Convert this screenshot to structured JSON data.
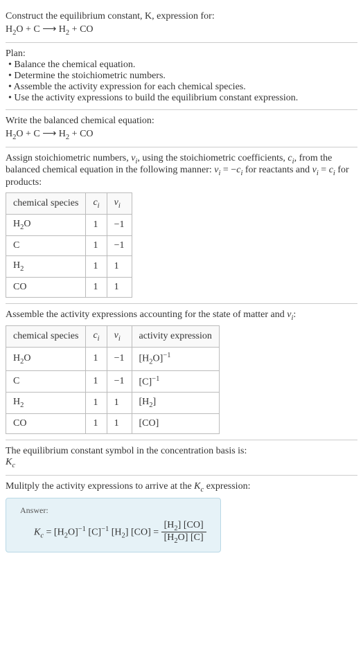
{
  "intro": {
    "prompt": "Construct the equilibrium constant, K, expression for:",
    "equation_lhs1": "H",
    "equation_lhs1_sub": "2",
    "equation_lhs2": "O + C",
    "arrow": " ⟶ ",
    "equation_rhs1": "H",
    "equation_rhs1_sub": "2",
    "equation_rhs2": " + CO"
  },
  "plan": {
    "title": "Plan:",
    "b1": "• Balance the chemical equation.",
    "b2": "• Determine the stoichiometric numbers.",
    "b3": "• Assemble the activity expression for each chemical species.",
    "b4": "• Use the activity expressions to build the equilibrium constant expression."
  },
  "balanced": {
    "title": "Write the balanced chemical equation:",
    "equation_lhs1": "H",
    "equation_lhs1_sub": "2",
    "equation_lhs2": "O + C",
    "arrow": " ⟶ ",
    "equation_rhs1": "H",
    "equation_rhs1_sub": "2",
    "equation_rhs2": " + CO"
  },
  "stoich": {
    "intro1": "Assign stoichiometric numbers, ",
    "nu_i": "ν",
    "sub_i": "i",
    "intro2": ", using the stoichiometric coefficients, ",
    "c_i": "c",
    "intro3": ", from the balanced chemical equation in the following manner: ",
    "eq1": " = −",
    "intro4": " for reactants and ",
    "eq2": " = ",
    "intro5": " for products:",
    "col1": "chemical species",
    "col2_c": "c",
    "col2_sub": "i",
    "col3_nu": "ν",
    "col3_sub": "i",
    "r1s": "H",
    "r1s_sub": "2",
    "r1s2": "O",
    "r1c": "1",
    "r1n": "−1",
    "r2s": "C",
    "r2c": "1",
    "r2n": "−1",
    "r3s": "H",
    "r3s_sub": "2",
    "r3c": "1",
    "r3n": "1",
    "r4s": "CO",
    "r4c": "1",
    "r4n": "1"
  },
  "activity": {
    "intro1": "Assemble the activity expressions accounting for the state of matter and ",
    "nu": "ν",
    "sub_i": "i",
    "intro2": ":",
    "col1": "chemical species",
    "col2_c": "c",
    "col2_sub": "i",
    "col3_nu": "ν",
    "col3_sub": "i",
    "col4": "activity expression",
    "r1s": "H",
    "r1s_sub": "2",
    "r1s2": "O",
    "r1c": "1",
    "r1n": "−1",
    "r1a_pre": "[H",
    "r1a_sub": "2",
    "r1a_mid": "O]",
    "r1a_sup": "−1",
    "r2s": "C",
    "r2c": "1",
    "r2n": "−1",
    "r2a_pre": "[C]",
    "r2a_sup": "−1",
    "r3s": "H",
    "r3s_sub": "2",
    "r3c": "1",
    "r3n": "1",
    "r3a_pre": "[H",
    "r3a_sub": "2",
    "r3a_post": "]",
    "r4s": "CO",
    "r4c": "1",
    "r4n": "1",
    "r4a": "[CO]"
  },
  "symbol": {
    "line1": "The equilibrium constant symbol in the concentration basis is:",
    "K": "K",
    "sub_c": "c"
  },
  "multiply": {
    "line1": "Mulitply the activity expressions to arrive at the ",
    "K": "K",
    "sub_c": "c",
    "line2": " expression:"
  },
  "answer": {
    "label": "Answer:",
    "K": "K",
    "sub_c": "c",
    "eq": " = ",
    "t1": "[H",
    "t1_sub": "2",
    "t1_post": "O]",
    "t1_sup": "−1",
    "sp": " ",
    "t2": "[C]",
    "t2_sup": "−1",
    "t3": "[H",
    "t3_sub": "2",
    "t3_post": "]",
    "t4": "[CO]",
    "eq2": " = ",
    "num1": "[H",
    "num1_sub": "2",
    "num1_post": "] [CO]",
    "den1": "[H",
    "den1_sub": "2",
    "den1_post": "O] [C]"
  },
  "chart_data": {
    "type": "table",
    "tables": [
      {
        "title": "Stoichiometric numbers",
        "columns": [
          "chemical species",
          "c_i",
          "nu_i"
        ],
        "rows": [
          [
            "H2O",
            1,
            -1
          ],
          [
            "C",
            1,
            -1
          ],
          [
            "H2",
            1,
            1
          ],
          [
            "CO",
            1,
            1
          ]
        ]
      },
      {
        "title": "Activity expressions",
        "columns": [
          "chemical species",
          "c_i",
          "nu_i",
          "activity expression"
        ],
        "rows": [
          [
            "H2O",
            1,
            -1,
            "[H2O]^-1"
          ],
          [
            "C",
            1,
            -1,
            "[C]^-1"
          ],
          [
            "H2",
            1,
            1,
            "[H2]"
          ],
          [
            "CO",
            1,
            1,
            "[CO]"
          ]
        ]
      }
    ]
  }
}
